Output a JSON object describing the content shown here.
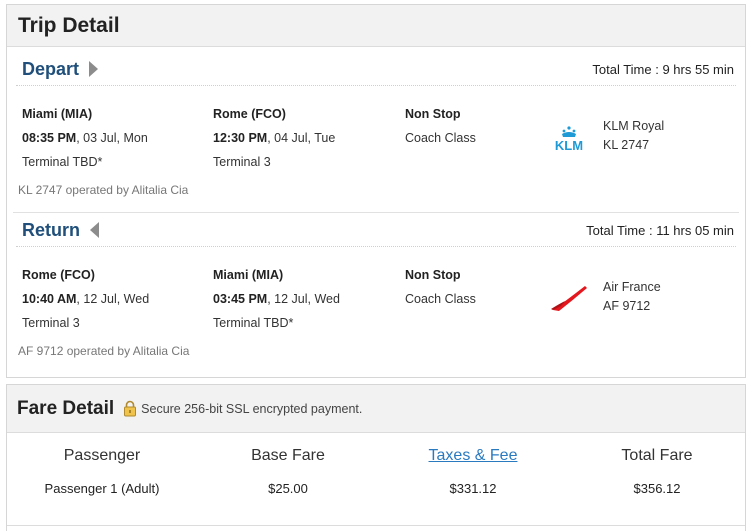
{
  "trip": {
    "title": "Trip Detail",
    "depart": {
      "label": "Depart",
      "total_time": "Total Time : 9 hrs 55 min",
      "from": {
        "place": "Miami (MIA)",
        "time": "08:35 PM",
        "date": ", 03 Jul, Mon",
        "terminal": "Terminal TBD*"
      },
      "to": {
        "place": "Rome (FCO)",
        "time": "12:30 PM",
        "date": ", 04 Jul, Tue",
        "terminal": "Terminal 3"
      },
      "stops": "Non Stop",
      "cabin": "Coach Class",
      "airline": {
        "name": "KLM Royal",
        "flight": "KL 2747",
        "logo": "klm-logo"
      },
      "operated": "KL 2747 operated by Alitalia Cia"
    },
    "return": {
      "label": "Return",
      "total_time": "Total Time : 11 hrs 05 min",
      "from": {
        "place": "Rome (FCO)",
        "time": "10:40 AM",
        "date": ", 12 Jul, Wed",
        "terminal": "Terminal 3"
      },
      "to": {
        "place": "Miami (MIA)",
        "time": "03:45 PM",
        "date": ", 12 Jul, Wed",
        "terminal": "Terminal TBD*"
      },
      "stops": "Non Stop",
      "cabin": "Coach Class",
      "airline": {
        "name": "Air France",
        "flight": "AF 9712",
        "logo": "air-france-logo"
      },
      "operated": "AF 9712 operated by Alitalia Cia"
    }
  },
  "fare": {
    "title": "Fare Detail",
    "secure_text": "Secure 256-bit SSL encrypted payment.",
    "headers": {
      "passenger": "Passenger",
      "base_fare": "Base Fare",
      "taxes": "Taxes & Fee",
      "total": "Total Fare"
    },
    "rows": [
      {
        "passenger": "Passenger 1 (Adult)",
        "base_fare": "$25.00",
        "taxes": "$331.12",
        "total": "$356.12"
      }
    ]
  },
  "colors": {
    "accent": "#1f4f7a",
    "link": "#2a7ac0",
    "klm": "#1e9ad6",
    "air_france": "#e3171d"
  }
}
